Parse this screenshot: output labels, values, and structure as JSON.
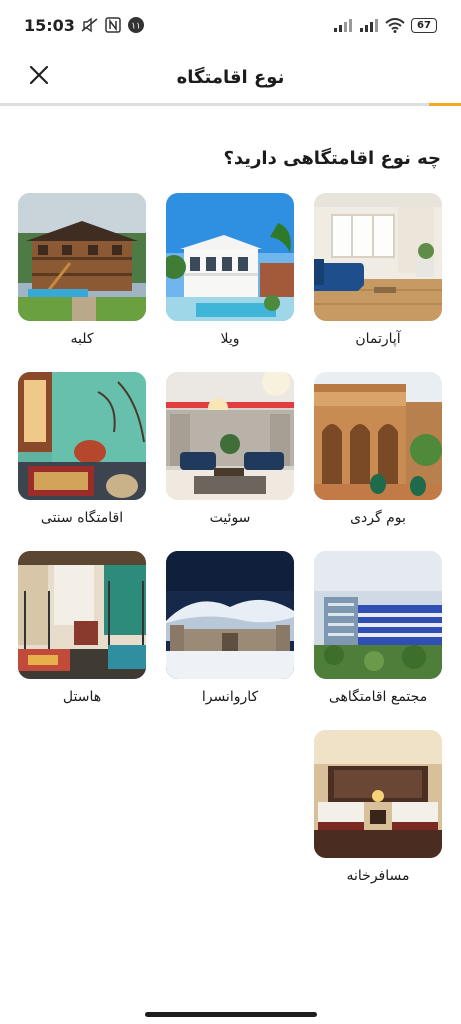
{
  "status_bar": {
    "time": "15:03",
    "notification_count": "۱۱",
    "battery": "67",
    "icons": [
      "mute-icon",
      "n-logo-icon",
      "notification-badge",
      "signal-1-icon",
      "signal-2-icon",
      "wifi-icon",
      "battery-icon"
    ]
  },
  "header": {
    "title": "نوع اقامتگاه",
    "close_icon": "close-icon"
  },
  "progress": {
    "value": 0.07,
    "color": "#f7a823",
    "track_color": "#dedede"
  },
  "question": "چه نوع اقامتگاهی دارید؟",
  "types": [
    {
      "label": "آپارتمان",
      "image": "apartment-photo"
    },
    {
      "label": "ویلا",
      "image": "villa-photo"
    },
    {
      "label": "کلبه",
      "image": "cabin-photo"
    },
    {
      "label": "بوم گردی",
      "image": "eco-lodge-photo"
    },
    {
      "label": "سوئیت",
      "image": "suite-photo"
    },
    {
      "label": "اقامتگاه سنتی",
      "image": "traditional-house-photo"
    },
    {
      "label": "مجتمع اقامتگاهی",
      "image": "hotel-complex-photo"
    },
    {
      "label": "کاروانسرا",
      "image": "caravanserai-photo"
    },
    {
      "label": "هاستل",
      "image": "hostel-photo"
    },
    {
      "label": "مسافرخانه",
      "image": "guesthouse-photo"
    }
  ]
}
